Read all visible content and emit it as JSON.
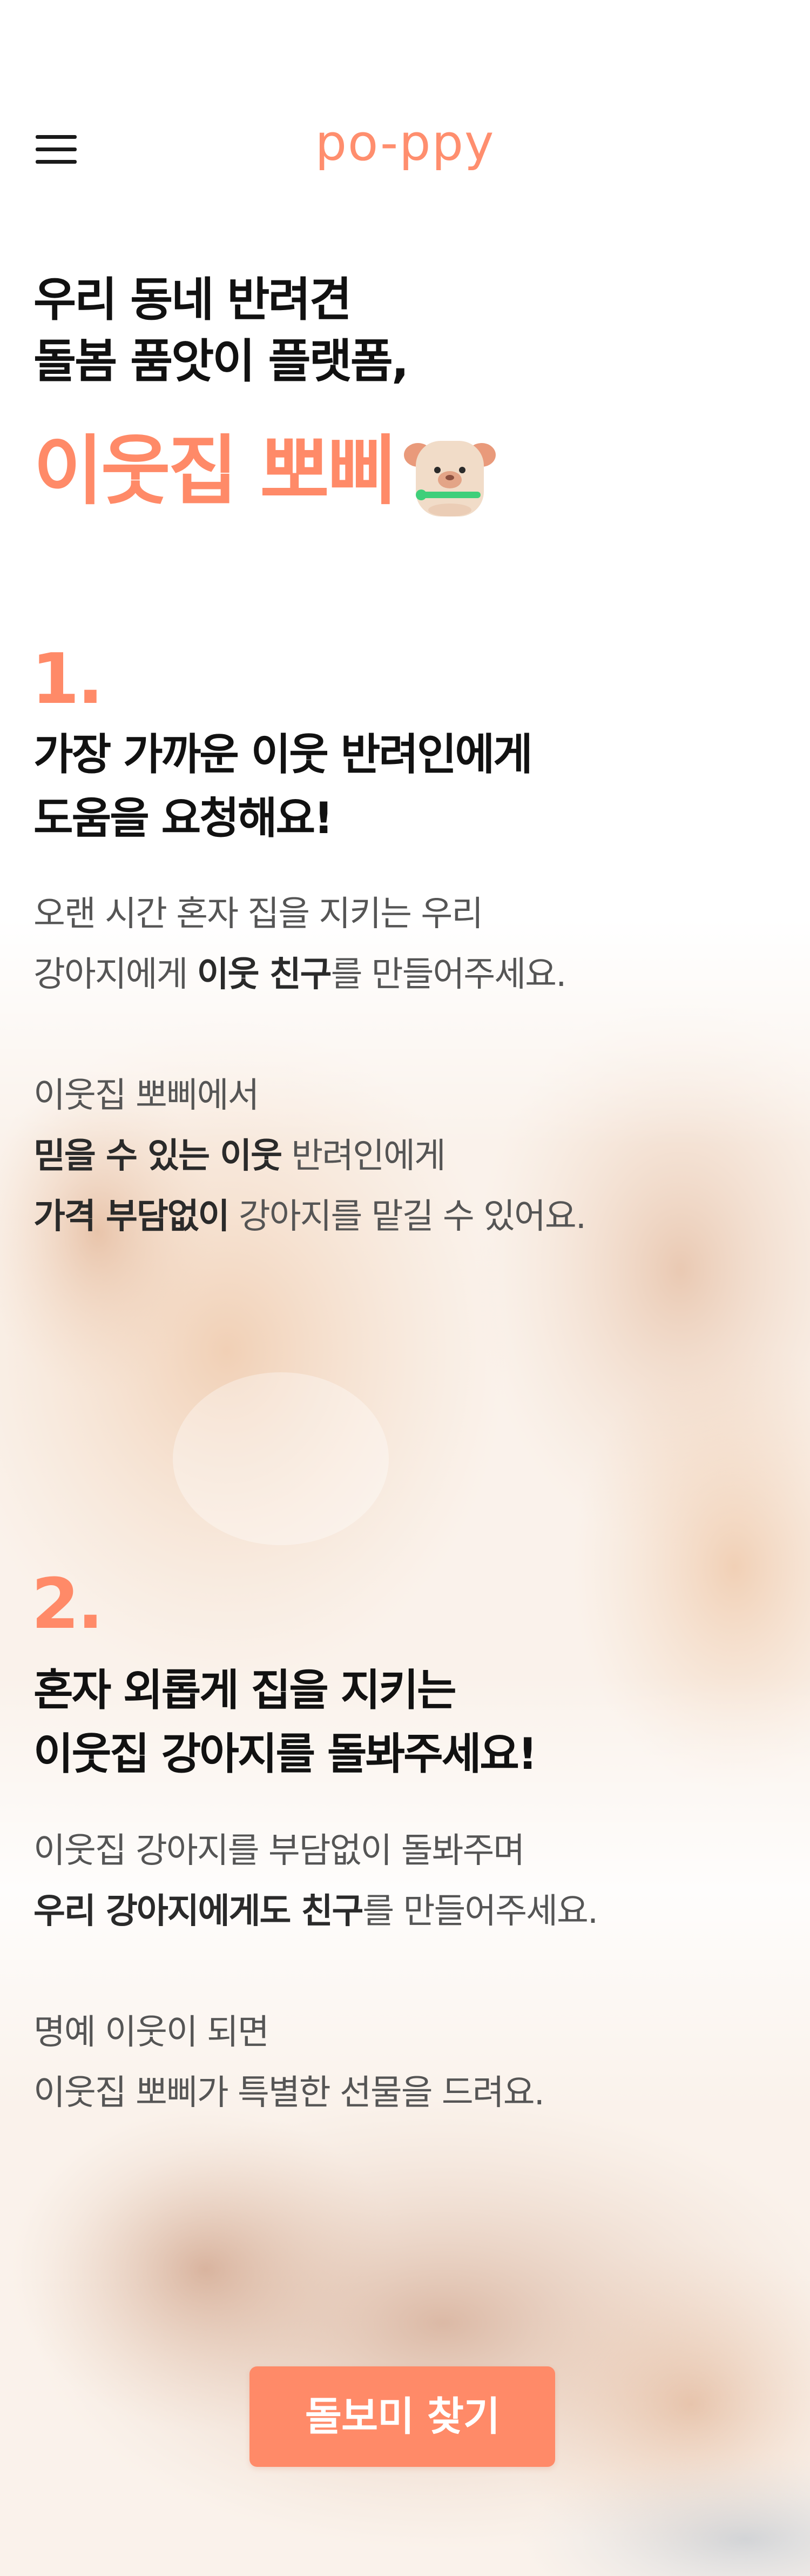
{
  "header": {
    "logo": "po-ppy",
    "menu_icon": "hamburger-menu-icon"
  },
  "hero": {
    "line1": "우리 동네 반려견",
    "line2": "돌봄 품앗이 플랫폼,",
    "brand": "이웃집 뽀삐",
    "mascot_icon": "puppy-mascot-icon"
  },
  "section1": {
    "number": "1.",
    "title_line1": "가장 가까운 이웃 반려인에게",
    "title_line2": "도움을 요청해요!",
    "p1_line1": "오랜 시간 혼자 집을 지키는 우리",
    "p1_line2_pre": "강아지에게 ",
    "p1_line2_bold": "이웃 친구",
    "p1_line2_post": "를 만들어주세요.",
    "p2_line1": "이웃집 뽀삐에서",
    "p2_line2_bold": "믿을 수 있는 이웃",
    "p2_line2_post": " 반려인에게",
    "p2_line3_bold": "가격 부담없이",
    "p2_line3_post": " 강아지를 맡길 수 있어요."
  },
  "section2": {
    "number": "2.",
    "title_line1": "혼자 외롭게 집을 지키는",
    "title_line2": "이웃집 강아지를 돌봐주세요!",
    "p1_line1": "이웃집 강아지를 부담없이 돌봐주며",
    "p1_line2_bold": "우리 강아지에게도 친구",
    "p1_line2_post": "를 만들어주세요.",
    "p2_line1": "명예 이웃이 되면",
    "p2_line2": "이웃집 뽀삐가 특별한 선물을 드려요."
  },
  "cta": {
    "label": "돌보미 찾기"
  },
  "colors": {
    "brand": "#ff8a68",
    "heading": "#111111",
    "body": "#555555"
  }
}
